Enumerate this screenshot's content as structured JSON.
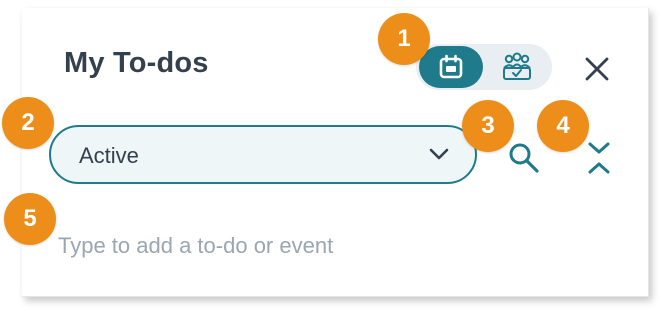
{
  "header": {
    "title": "My To-dos",
    "view_toggle": {
      "options": [
        {
          "icon": "calendar-icon",
          "selected": true
        },
        {
          "icon": "team-icon",
          "selected": false
        }
      ]
    },
    "close_icon": "close-icon"
  },
  "filter": {
    "selected": "Active",
    "chevron_icon": "chevron-down-icon"
  },
  "actions": {
    "search_icon": "search-icon",
    "collapse_icon": "collapse-icon"
  },
  "todo_input": {
    "value": "",
    "placeholder": "Type to add a to-do or event"
  },
  "callouts": [
    "1",
    "2",
    "3",
    "4",
    "5"
  ],
  "colors": {
    "accent": "#1f7a8c",
    "callout": "#ed8e1a",
    "title_text": "#33404d",
    "placeholder": "#9aa6b2",
    "toggle_track": "#e8eef2"
  }
}
